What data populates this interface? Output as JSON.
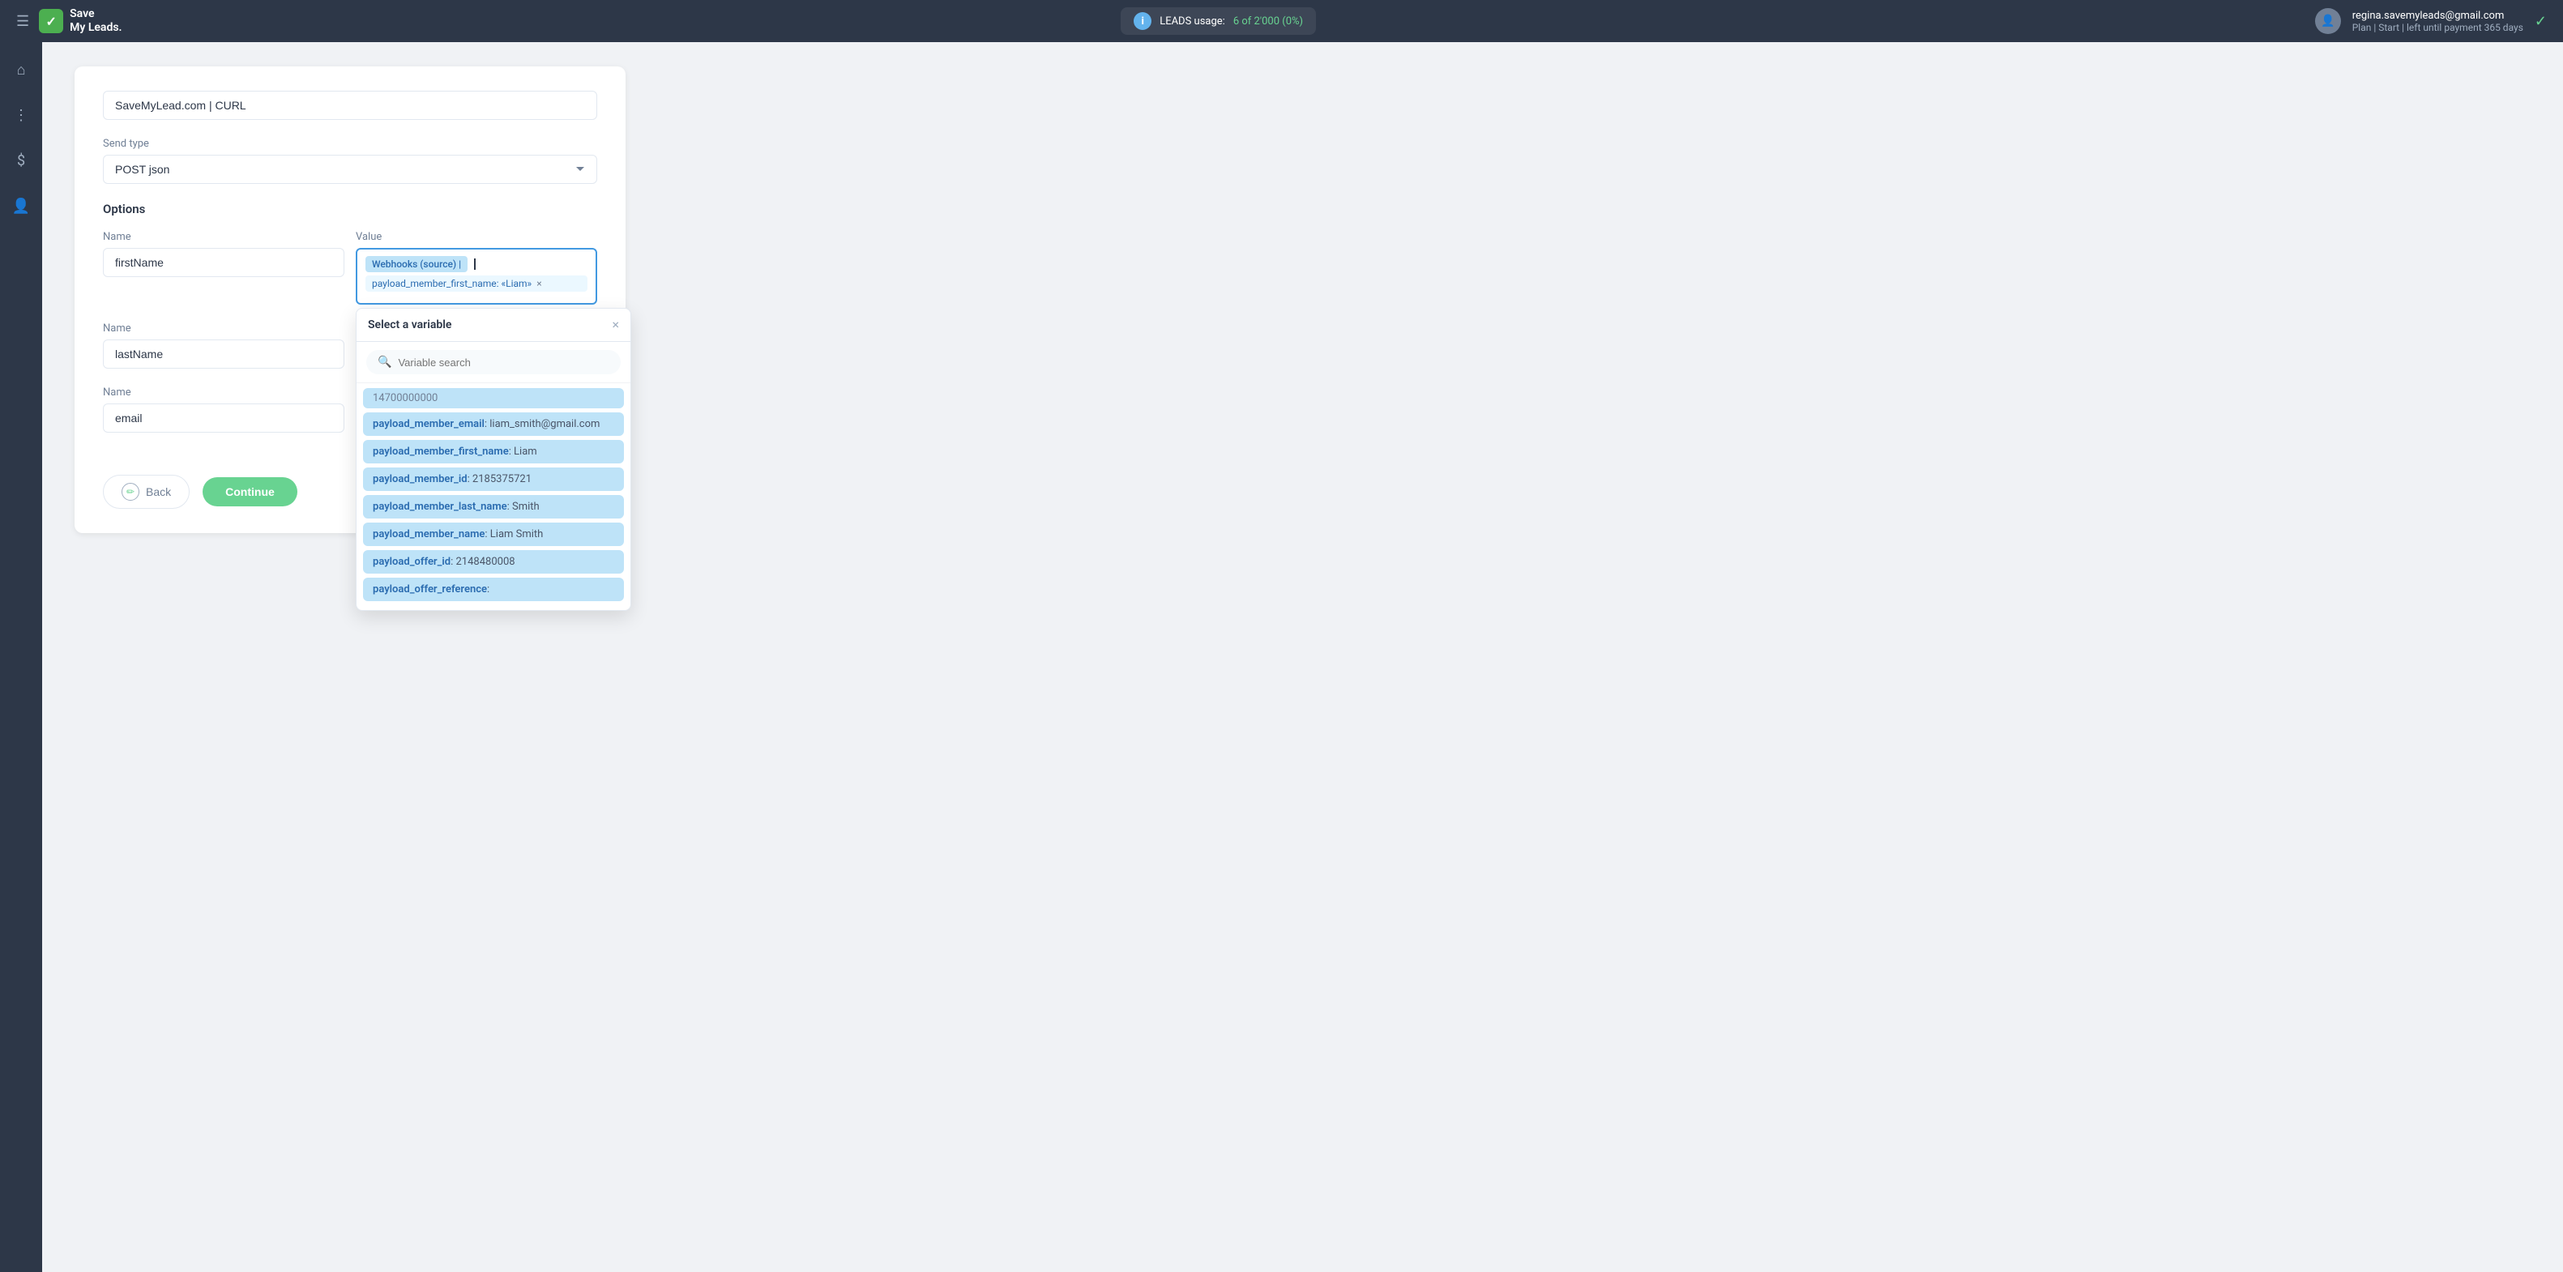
{
  "topnav": {
    "hamburger_icon": "☰",
    "logo_check": "✓",
    "logo_line1": "Save",
    "logo_line2": "My Leads.",
    "leads_label": "LEADS usage:",
    "leads_count": "6 of 2'000 (0%)",
    "user_email": "regina.savemyleads@gmail.com",
    "user_plan": "Plan | Start | left until payment 365 days",
    "checkmark": "✓"
  },
  "sidebar": {
    "icons": [
      "⌂",
      "⋮",
      "$",
      "👤"
    ]
  },
  "form": {
    "name_input_value": "SaveMyLead.com | CURL",
    "send_type_label": "Send type",
    "send_type_value": "POST json",
    "options_label": "Options",
    "name_label": "Name",
    "value_label": "Value",
    "row1": {
      "name_value": "firstName",
      "tag_source": "Webhooks (source) |",
      "tag_payload": "payload_member_first_name: «Liam»"
    },
    "row2": {
      "name_value": "lastName"
    },
    "row3": {
      "name_value": "email"
    },
    "back_label": "Back",
    "continue_label": "Continue"
  },
  "dropdown": {
    "title": "Select a variable",
    "close_icon": "×",
    "search_placeholder": "Variable search",
    "items": [
      {
        "key": "payload_member_email",
        "value": "liam_smith@gmail.com"
      },
      {
        "key": "payload_member_first_name",
        "value": "Liam"
      },
      {
        "key": "payload_member_id",
        "value": "2185375721"
      },
      {
        "key": "payload_member_last_name",
        "value": "Smith"
      },
      {
        "key": "payload_member_name",
        "value": "Liam Smith"
      },
      {
        "key": "payload_offer_id",
        "value": "2148480008"
      },
      {
        "key": "payload_offer_reference",
        "value": "..."
      }
    ],
    "truncated_item": "14700000000"
  }
}
